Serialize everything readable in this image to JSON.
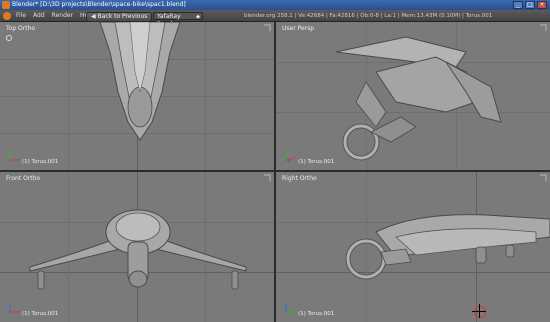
{
  "window": {
    "title": "Blender* [D:\\3D projects\\Blender\\space-bike\\spac1.blend]",
    "minimize_glyph": "_",
    "maximize_glyph": "□",
    "close_glyph": "×"
  },
  "menubar": {
    "menus": [
      "File",
      "Add",
      "Render",
      "Help"
    ],
    "back_button": "Back to Previous",
    "back_arrow": "◀",
    "renderer": "YafaRay Render",
    "renderer_caret": "◆",
    "stats": "blender.org 258.1 | Ve:42684 | Fa:42816 | Ob:0-8 | La:1 | Mem:13.43M (0.10M) | Torus.001"
  },
  "viewports": {
    "top_left": {
      "label": "Top Ortho",
      "object": "(1) Torus.001"
    },
    "top_right": {
      "label": "User Persp",
      "object": "(1) Torus.001"
    },
    "bottom_left": {
      "label": "Front Ortho",
      "object": "(1) Torus.001"
    },
    "bottom_right": {
      "label": "Right Ortho",
      "object": "(1) Torus.001"
    }
  },
  "colors": {
    "viewport_bg": "#7a7a7a",
    "model_fill": "#a9a9a9",
    "titlebar": "#2a4f8e",
    "accent": "#e07a22"
  }
}
